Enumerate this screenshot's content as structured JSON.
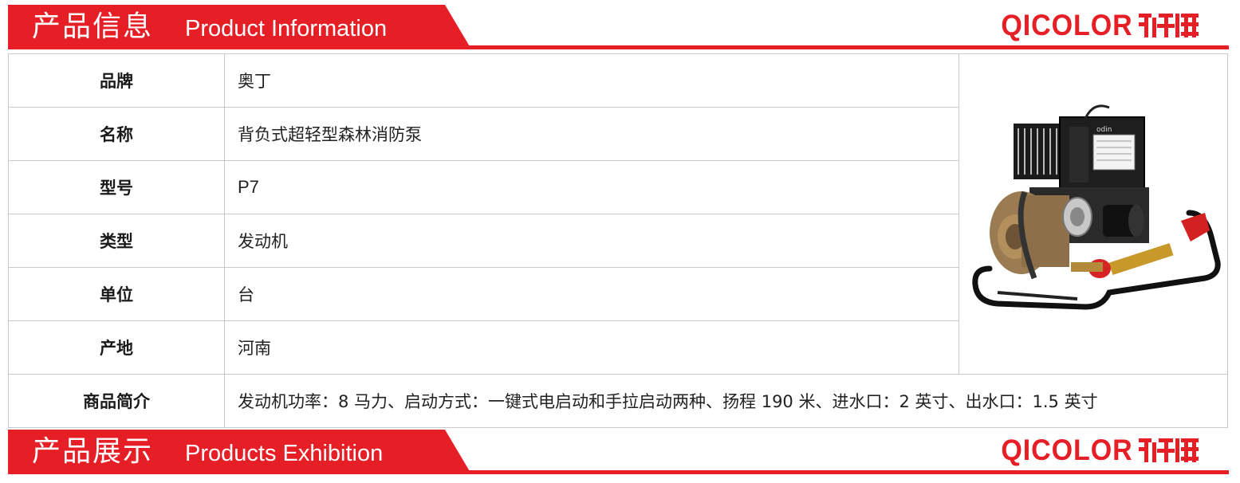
{
  "header_info": {
    "cn": "产品信息",
    "en": "Product Information",
    "brand": "QICOLOR",
    "brand_cn": "齐彩"
  },
  "rows": [
    {
      "label": "品牌",
      "value": "奥丁"
    },
    {
      "label": "名称",
      "value": "背负式超轻型森林消防泵"
    },
    {
      "label": "型号",
      "value": "P7"
    },
    {
      "label": "类型",
      "value": "发动机"
    },
    {
      "label": "单位",
      "value": "台"
    },
    {
      "label": "产地",
      "value": "河南"
    }
  ],
  "intro": {
    "label": "商品简介",
    "value": "发动机功率：8 马力、启动方式：一键式电启动和手拉启动两种、扬程 190 米、进水口：2 英寸、出水口：1.5 英寸"
  },
  "product_image": {
    "label_text": "odin"
  },
  "header_exhibit": {
    "cn": "产品展示",
    "en": "Products Exhibition",
    "brand": "QICOLOR",
    "brand_cn": "齐彩"
  },
  "colors": {
    "accent": "#e61e25",
    "border": "#c9c9c9"
  }
}
